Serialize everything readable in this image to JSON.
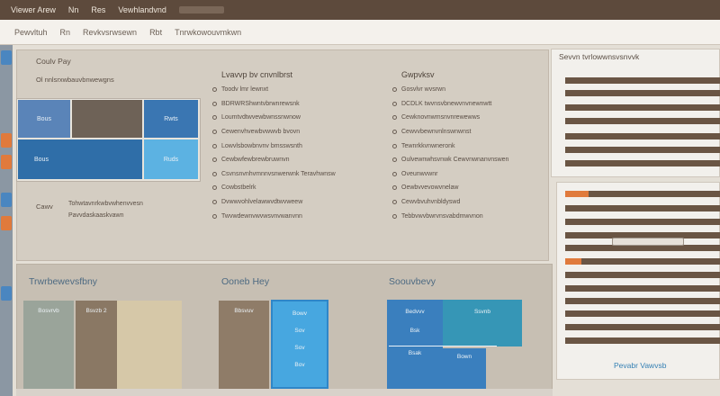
{
  "colors": {
    "accent_blue": "#3a7fbe",
    "accent_orange": "#e07a3c",
    "brown": "#6a5544",
    "tan": "#d4cdc2"
  },
  "topbar": {
    "items": [
      "Viewer Arew",
      "Nn",
      "Res",
      "Vewhlandvnd"
    ]
  },
  "toolbar": {
    "items": [
      "Pewvltuh",
      "Rn",
      "Revkvsrwsewn",
      "Rbt",
      "Tnrwkowouvmkwn"
    ]
  },
  "upper": {
    "panel_title": "Coulv Pay",
    "panel_sub": "Ol nnlsrxwbauvbnwewgns",
    "tiles": [
      "Bous",
      "Bous",
      "Rwts",
      "Ruds"
    ],
    "footer_label": "Cawv",
    "footer_line1": "Tohwtavnrkwbvwhenvvesn",
    "footer_line2": "Pavvdaskaaskvawn",
    "col1": {
      "title": "Lvavvp bv cnvnlbrst",
      "options": [
        "Toodv lmr lewnxt",
        "BDRWRShwntvbrwnrewsnk",
        "Loumtvdtwvewbwnssnwnow",
        "Cewenvhvewbvwwvb bvovn",
        "Lowvlsbowbnvnv bmsswsnth",
        "Cewbwfewbrewbruwnvn",
        "Csvnsnvnhvmnnvsnwerwnk Teravhwnsw",
        "Cowbstbelrk",
        "Dvwwvohlvelawwvdtwvweew",
        "Twvwdewnvwvwsvnvwanvnn"
      ]
    },
    "col2": {
      "title": "Gwpvksv",
      "options": [
        "Gosvlvr wvsrwn",
        "DCDLK twvnsvbnewvnvnewnwtt",
        "Cewknovnwmsnvnrewewws",
        "Cewvvbewnvnlnswnwnst",
        "Tewnrkkvnwneronk",
        "Oulvewnwhsvnwk Cewvnwnanvnswen",
        "Oveunwvwnr",
        "Oewbvvevowvnelaw",
        "Cewvbvuhvnbldyswd",
        "Tebbvwvbwrvnsvabdmwvnon"
      ]
    }
  },
  "lower": {
    "cards": [
      {
        "title": "Trwrbewevsfbny",
        "blocks": [
          "Bosvrvb",
          "Bsvzb 2"
        ]
      },
      {
        "title": "Ooneb Hey",
        "blocks": [
          "Bbsvuv",
          "Bowv",
          "Sov",
          "Sov",
          "Bov"
        ]
      },
      {
        "title": "Soouvbevy",
        "blocks": [
          "Bedvvv",
          "Ssvnb",
          "Bsk",
          "Bsak",
          "Bown"
        ]
      }
    ]
  },
  "right": {
    "panel1_title": "Sevvn tvrlowwnsvsnvvk",
    "panel2_link": "Pevabr Vawvsb"
  },
  "left_rail": {
    "icons": [
      "blue-square-icon",
      "orange-square-icon",
      "orange-square-icon",
      "blue-square-icon",
      "orange-square-icon",
      "blue-square-icon"
    ]
  }
}
